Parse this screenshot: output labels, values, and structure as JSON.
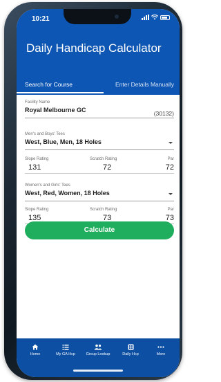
{
  "status": {
    "time": "10:21"
  },
  "header": {
    "title": "Daily Handicap Calculator"
  },
  "tabs": [
    {
      "label": "Search for Course",
      "active": true
    },
    {
      "label": "Enter Details Manually",
      "active": false
    }
  ],
  "facility": {
    "label": "Facility Name",
    "value": "Royal Melbourne GC",
    "code": "(30132)"
  },
  "mens_tees": {
    "label": "Men's and Boys' Tees",
    "value": "West, Blue, Men, 18 Holes",
    "slope_label": "Slope Rating",
    "slope": "131",
    "scratch_label": "Scratch Rating",
    "scratch": "72",
    "par_label": "Par",
    "par": "72"
  },
  "womens_tees": {
    "label": "Women's and Girls' Tees",
    "value": "West, Red, Women, 18 Holes",
    "slope_label": "Slope Rating",
    "slope": "135",
    "scratch_label": "Scratch Rating",
    "scratch": "73",
    "par_label": "Par",
    "par": "73"
  },
  "actions": {
    "calculate": "Calculate"
  },
  "tabbar": [
    {
      "label": "Home",
      "icon": "home-icon"
    },
    {
      "label": "My GA Hcp",
      "icon": "list-icon"
    },
    {
      "label": "Group Lookup",
      "icon": "group-icon"
    },
    {
      "label": "Daily Hcp",
      "icon": "calculator-icon"
    },
    {
      "label": "More",
      "icon": "more-icon"
    }
  ],
  "colors": {
    "primary": "#0e56b3",
    "accent": "#1fae5d"
  }
}
